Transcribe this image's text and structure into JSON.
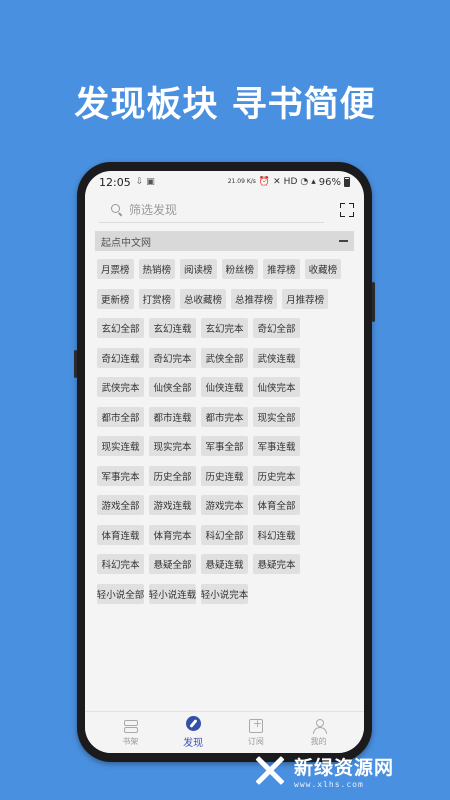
{
  "headline": "发现板块  寻书简便",
  "status_bar": {
    "time": "12:05",
    "net_speed": "21.09 K/s",
    "network_label": "HD",
    "battery": "96%"
  },
  "search": {
    "placeholder": "筛选发现"
  },
  "section": {
    "title": "起点中文网"
  },
  "tags_rank": [
    "月票榜",
    "热销榜",
    "阅读榜",
    "粉丝榜",
    "推荐榜",
    "收藏榜",
    "更新榜",
    "打赏榜",
    "总收藏榜",
    "总推荐榜",
    "月推荐榜"
  ],
  "tags_category": [
    "玄幻全部",
    "玄幻连载",
    "玄幻完本",
    "奇幻全部",
    "奇幻连载",
    "奇幻完本",
    "武侠全部",
    "武侠连载",
    "武侠完本",
    "仙侠全部",
    "仙侠连载",
    "仙侠完本",
    "都市全部",
    "都市连载",
    "都市完本",
    "现实全部",
    "现实连载",
    "现实完本",
    "军事全部",
    "军事连载",
    "军事完本",
    "历史全部",
    "历史连载",
    "历史完本",
    "游戏全部",
    "游戏连载",
    "游戏完本",
    "体育全部",
    "体育连载",
    "体育完本",
    "科幻全部",
    "科幻连载",
    "科幻完本",
    "悬疑全部",
    "悬疑连载",
    "悬疑完本",
    "轻小说全部",
    "轻小说连载",
    "轻小说完本"
  ],
  "tabs": [
    {
      "label": "书架",
      "icon": "bookshelf-icon",
      "active": false
    },
    {
      "label": "发现",
      "icon": "compass-icon",
      "active": true
    },
    {
      "label": "订阅",
      "icon": "subscribe-icon",
      "active": false
    },
    {
      "label": "我的",
      "icon": "profile-icon",
      "active": false
    }
  ],
  "watermark": {
    "title": "新绿资源网",
    "url": "www.xlhs.com"
  },
  "colors": {
    "background": "#4a90e0",
    "accent": "#3450a8"
  }
}
